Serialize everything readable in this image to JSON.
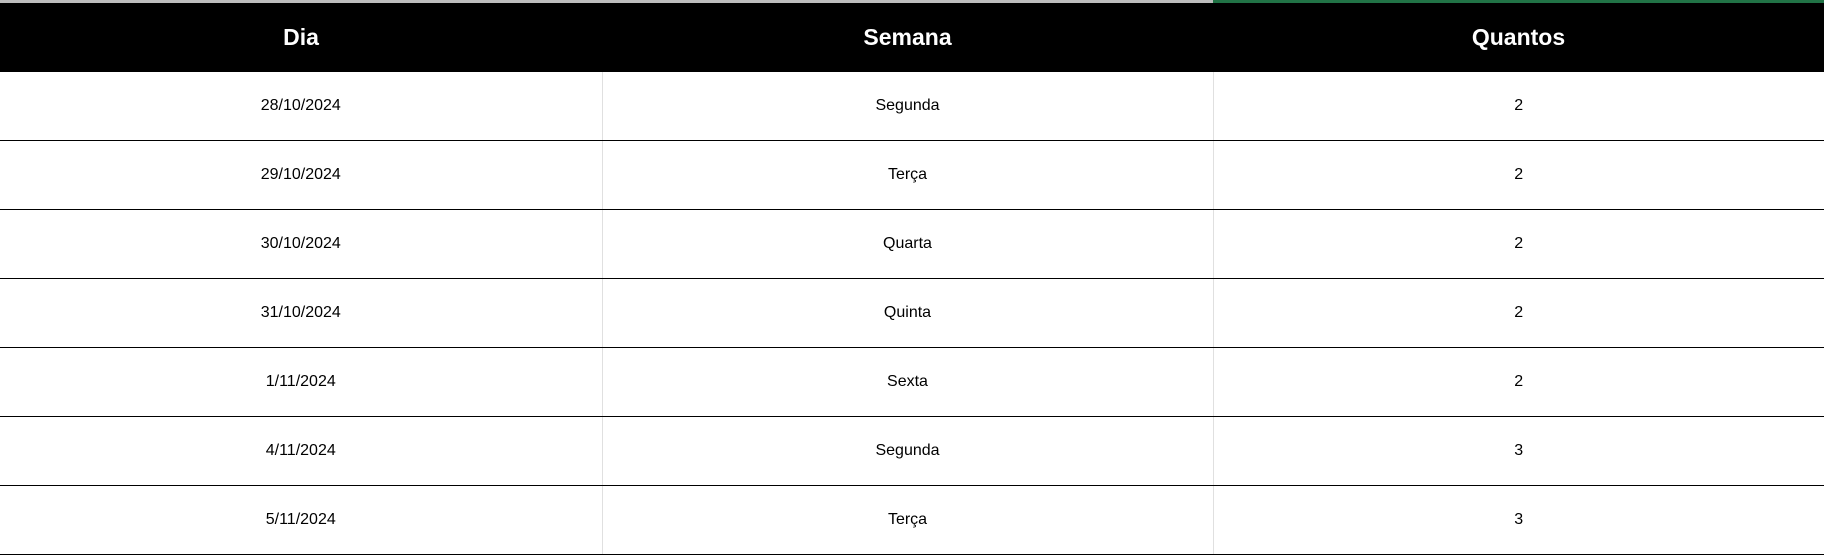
{
  "table": {
    "headers": [
      "Dia",
      "Semana",
      "Quantos"
    ],
    "rows": [
      [
        "28/10/2024",
        "Segunda",
        "2"
      ],
      [
        "29/10/2024",
        "Terça",
        "2"
      ],
      [
        "30/10/2024",
        "Quarta",
        "2"
      ],
      [
        "31/10/2024",
        "Quinta",
        "2"
      ],
      [
        "1/11/2024",
        "Sexta",
        "2"
      ],
      [
        "4/11/2024",
        "Segunda",
        "3"
      ],
      [
        "5/11/2024",
        "Terça",
        "3"
      ]
    ]
  },
  "colors": {
    "header_bg": "#000000",
    "header_text": "#ffffff",
    "selection_accent": "#217346"
  }
}
